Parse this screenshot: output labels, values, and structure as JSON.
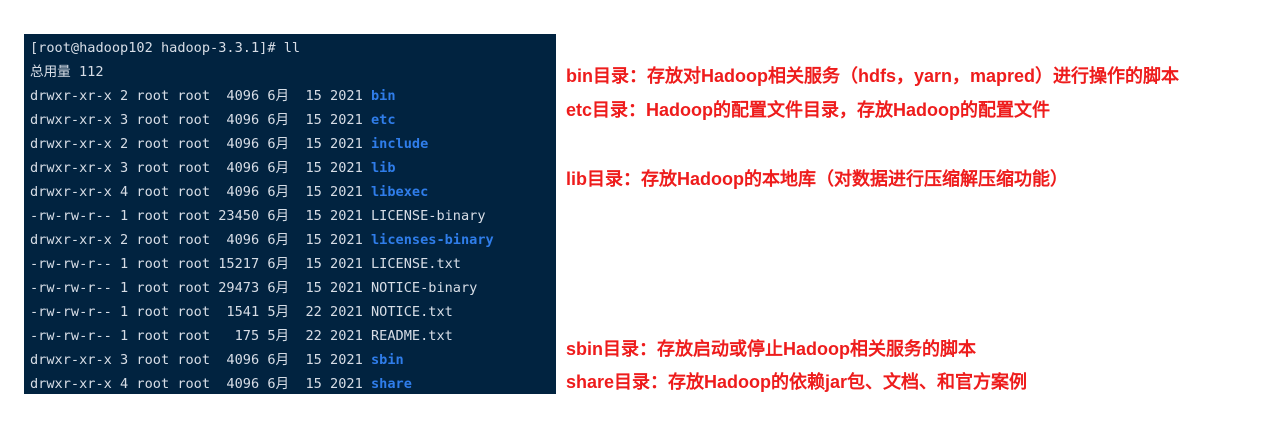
{
  "terminal": {
    "prompt": "[root@hadoop102 hadoop-3.3.1]# ll",
    "total": "总用量 112",
    "entries": [
      {
        "info": "drwxr-xr-x 2 root root  4096 6月  15 2021 ",
        "name": "bin",
        "is_dir": true
      },
      {
        "info": "drwxr-xr-x 3 root root  4096 6月  15 2021 ",
        "name": "etc",
        "is_dir": true
      },
      {
        "info": "drwxr-xr-x 2 root root  4096 6月  15 2021 ",
        "name": "include",
        "is_dir": true
      },
      {
        "info": "drwxr-xr-x 3 root root  4096 6月  15 2021 ",
        "name": "lib",
        "is_dir": true
      },
      {
        "info": "drwxr-xr-x 4 root root  4096 6月  15 2021 ",
        "name": "libexec",
        "is_dir": true
      },
      {
        "info": "-rw-rw-r-- 1 root root 23450 6月  15 2021 ",
        "name": "LICENSE-binary",
        "is_dir": false
      },
      {
        "info": "drwxr-xr-x 2 root root  4096 6月  15 2021 ",
        "name": "licenses-binary",
        "is_dir": true
      },
      {
        "info": "-rw-rw-r-- 1 root root 15217 6月  15 2021 ",
        "name": "LICENSE.txt",
        "is_dir": false
      },
      {
        "info": "-rw-rw-r-- 1 root root 29473 6月  15 2021 ",
        "name": "NOTICE-binary",
        "is_dir": false
      },
      {
        "info": "-rw-rw-r-- 1 root root  1541 5月  22 2021 ",
        "name": "NOTICE.txt",
        "is_dir": false
      },
      {
        "info": "-rw-rw-r-- 1 root root   175 5月  22 2021 ",
        "name": "README.txt",
        "is_dir": false
      },
      {
        "info": "drwxr-xr-x 3 root root  4096 6月  15 2021 ",
        "name": "sbin",
        "is_dir": true
      },
      {
        "info": "drwxr-xr-x 4 root root  4096 6月  15 2021 ",
        "name": "share",
        "is_dir": true
      }
    ]
  },
  "annotations": {
    "bin": "bin目录：存放对Hadoop相关服务（hdfs，yarn，mapred）进行操作的脚本",
    "etc": "etc目录：Hadoop的配置文件目录，存放Hadoop的配置文件",
    "lib": "lib目录：存放Hadoop的本地库（对数据进行压缩解压缩功能）",
    "sbin": "sbin目录：存放启动或停止Hadoop相关服务的脚本",
    "share": "share目录：存放Hadoop的依赖jar包、文档、和官方案例"
  },
  "colors": {
    "terminal_bg": "#012340",
    "terminal_text": "#d7dde6",
    "directory": "#2f7dea",
    "annotation": "#ee1c1c"
  }
}
